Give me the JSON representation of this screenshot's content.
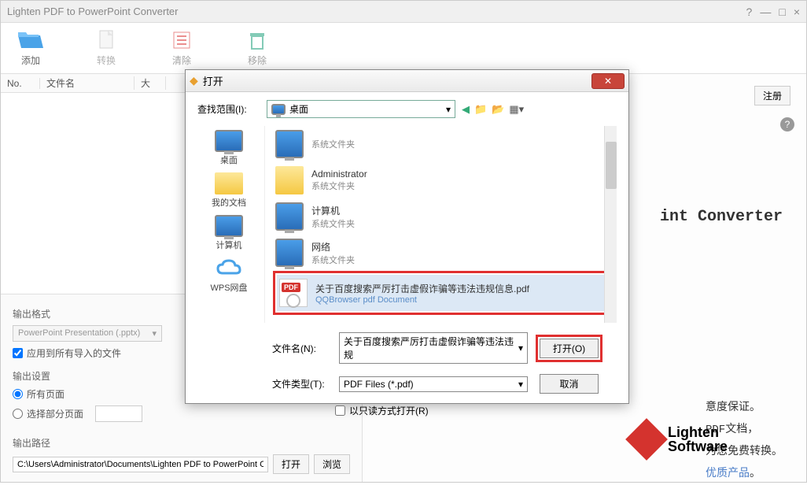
{
  "app": {
    "title": "Lighten PDF to PowerPoint Converter"
  },
  "toolbar": {
    "add": "添加",
    "convert": "转换",
    "clear": "清除",
    "remove": "移除"
  },
  "table": {
    "col_no": "No.",
    "col_name": "文件名",
    "col_size": "大"
  },
  "output": {
    "format_label": "输出格式",
    "format_value": "PowerPoint Presentation (.pptx)",
    "apply_all": "应用到所有导入的文件",
    "settings_label": "输出设置",
    "all_pages": "所有页面",
    "select_pages": "选择部分页面",
    "path_label": "输出路径",
    "path_value": "C:\\Users\\Administrator\\Documents\\Lighten PDF to PowerPoint Conver",
    "open_btn": "打开",
    "browse_btn": "浏览"
  },
  "nav": {
    "sep": "/",
    "register": "注册"
  },
  "promo": {
    "title_suffix": "int Converter",
    "line1": "意度保证。",
    "line2": "PDF文档，",
    "line3": "为您免费转换。",
    "link": "优质产品",
    "link_suffix": "。",
    "logo1": "Lighten",
    "logo2": "Software"
  },
  "dialog": {
    "title": "打开",
    "lookin_label": "查找范围(I):",
    "lookin_value": "桌面",
    "places": {
      "desktop": "桌面",
      "mydocs": "我的文档",
      "computer": "计算机",
      "wps": "WPS网盘"
    },
    "files": {
      "sysfolder": "系统文件夹",
      "admin": "Administrator",
      "computer": "计算机",
      "network": "网络",
      "pdf_name": "关于百度搜索严厉打击虚假诈骗等违法违规信息.pdf",
      "pdf_type": "QQBrowser pdf Document",
      "pdf_badge": "PDF"
    },
    "filename_label": "文件名(N):",
    "filename_value": "关于百度搜索严厉打击虚假诈骗等违法违规",
    "filetype_label": "文件类型(T):",
    "filetype_value": "PDF Files (*.pdf)",
    "open_btn": "打开(O)",
    "cancel_btn": "取消",
    "readonly": "以只读方式打开(R)"
  }
}
